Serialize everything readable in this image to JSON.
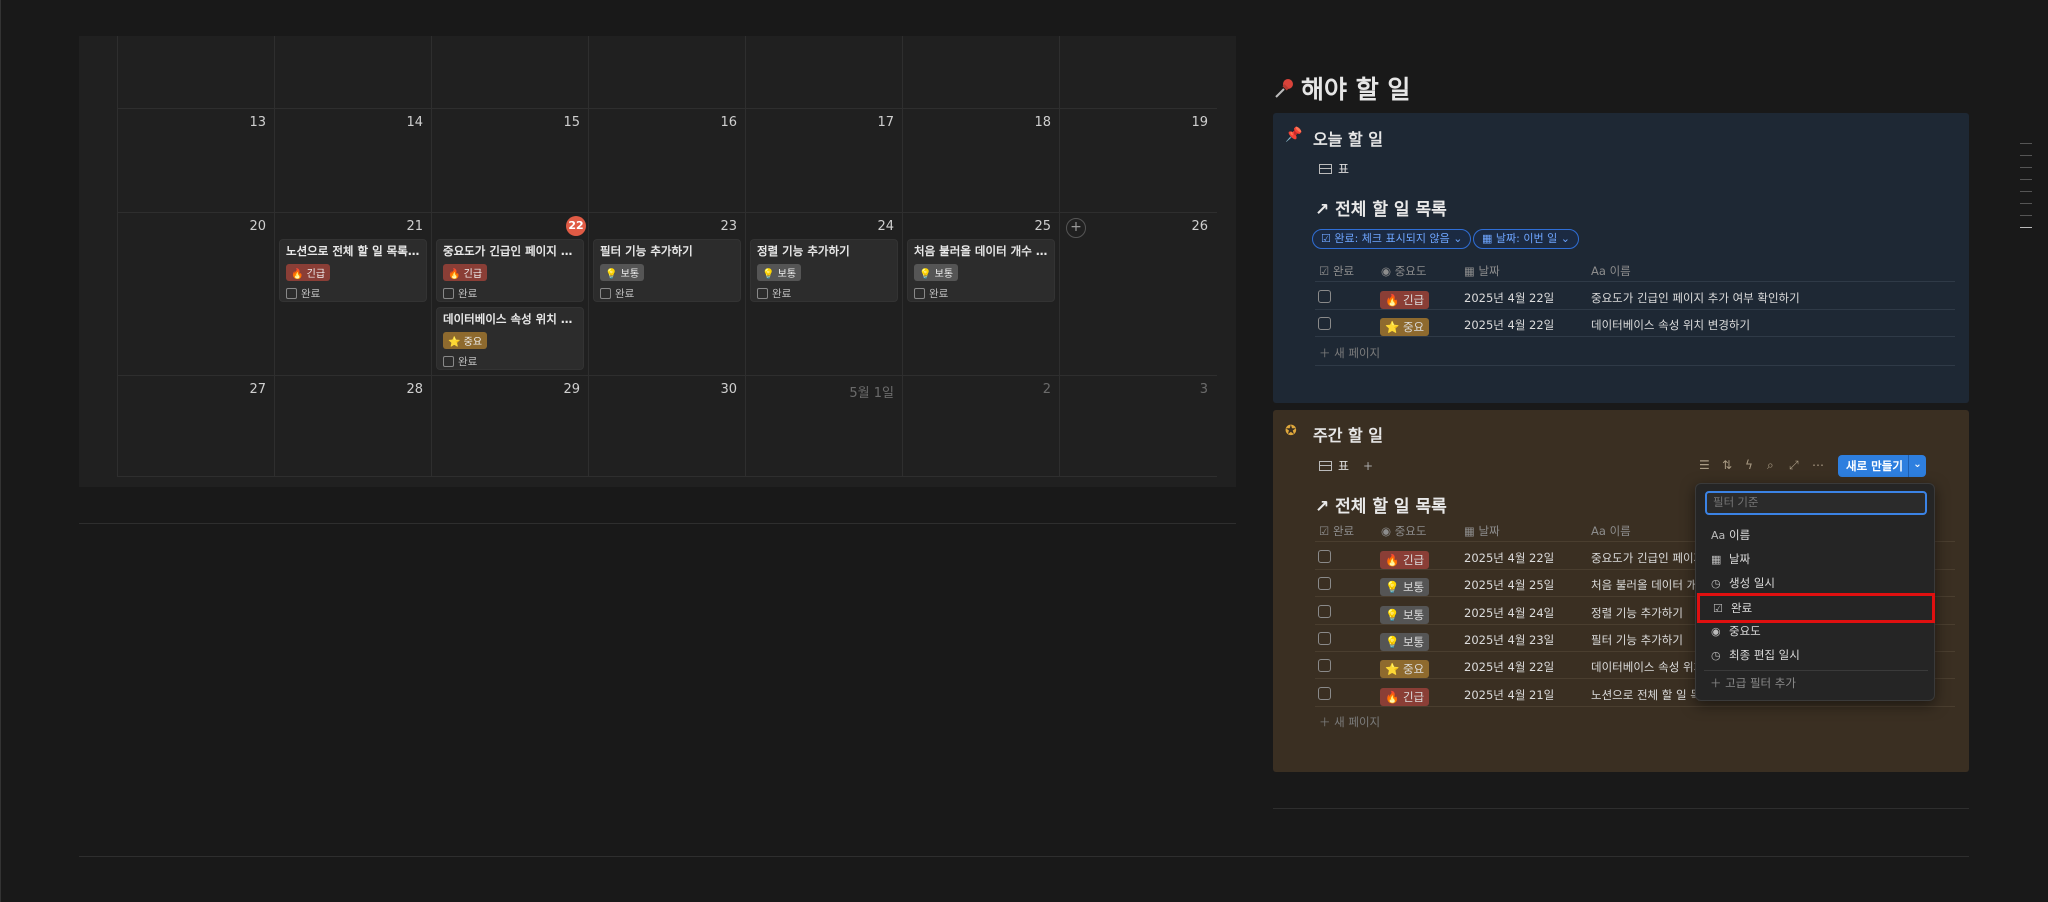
{
  "calendar": {
    "weeks": [
      {
        "days": [
          "13",
          "14",
          "15",
          "16",
          "17",
          "18",
          "19"
        ]
      },
      {
        "days": [
          "20",
          "21",
          "22",
          "23",
          "24",
          "25",
          "26"
        ]
      },
      {
        "days": [
          "27",
          "28",
          "29",
          "30",
          "5월 1일",
          "2",
          "3"
        ]
      }
    ],
    "cards": [
      {
        "title": "노션으로 전체 할 일 목록 만...",
        "tag": "🔥 긴급",
        "done_label": "완료"
      },
      {
        "title": "중요도가 긴급인 페이지 추...",
        "tag": "🔥 긴급",
        "done_label": "완료"
      },
      {
        "title": "데이터베이스 속성 위치 변...",
        "tag": "⭐ 중요",
        "done_label": "완료"
      },
      {
        "title": "필터 기능 추가하기",
        "tag": "💡 보통",
        "done_label": "완료"
      },
      {
        "title": "정렬 기능 추가하기",
        "tag": "💡 보통",
        "done_label": "완료"
      },
      {
        "title": "처음 불러올 데이터 개수 지...",
        "tag": "💡 보통",
        "done_label": "완료"
      }
    ],
    "add_symbol": "+"
  },
  "right": {
    "heading": "해야 할 일",
    "today": {
      "title": "오늘 할 일",
      "view_tab": "표",
      "db_title": "전체 할 일 목록",
      "filters": [
        "완료: 체크 표시되지 않음",
        "날짜: 이번 일"
      ],
      "columns": [
        "완료",
        "중요도",
        "날짜",
        "이름"
      ],
      "rows": [
        {
          "priority": "🔥 긴급",
          "date": "2025년 4월 22일",
          "name": "중요도가 긴급인 페이지 추가 여부 확인하기"
        },
        {
          "priority": "⭐ 중요",
          "date": "2025년 4월 22일",
          "name": "데이터베이스 속성 위치 변경하기"
        }
      ],
      "new_page": "새 페이지"
    },
    "weekly": {
      "title": "주간 할 일",
      "view_tab": "표",
      "new_button": "새로 만들기",
      "db_title": "전체 할 일 목록",
      "columns": [
        "완료",
        "중요도",
        "날짜",
        "이름"
      ],
      "rows": [
        {
          "priority": "🔥 긴급",
          "date": "2025년 4월 22일",
          "name": "중요도가 긴급인 페이지"
        },
        {
          "priority": "💡 보통",
          "date": "2025년 4월 25일",
          "name": "처음 불러올 데이터 개수"
        },
        {
          "priority": "💡 보통",
          "date": "2025년 4월 24일",
          "name": "정렬 기능 추가하기"
        },
        {
          "priority": "💡 보통",
          "date": "2025년 4월 23일",
          "name": "필터 기능 추가하기"
        },
        {
          "priority": "⭐ 중요",
          "date": "2025년 4월 22일",
          "name": "데이터베이스 속성 위치"
        },
        {
          "priority": "🔥 긴급",
          "date": "2025년 4월 21일",
          "name": "노션으로 전체 할 일 목"
        }
      ],
      "new_page": "새 페이지"
    },
    "filter_menu": {
      "placeholder": "필터 기준",
      "items": [
        "이름",
        "날짜",
        "생성 일시",
        "완료",
        "중요도",
        "최종 편집 일시"
      ],
      "advanced": "고급 필터 추가"
    }
  },
  "colors": {
    "accent": "#2e7fdf",
    "highlight": "#e01010",
    "today": "#e05b45"
  }
}
